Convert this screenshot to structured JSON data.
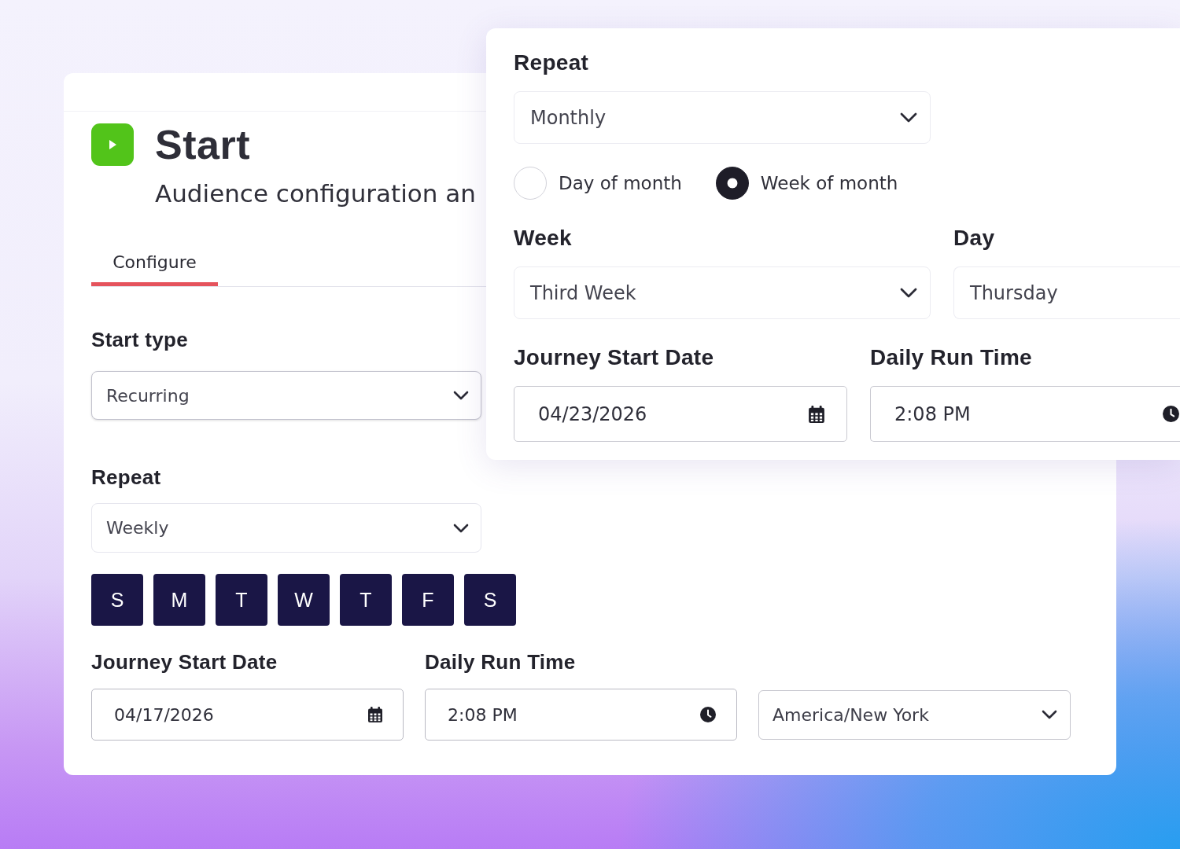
{
  "card": {
    "title": "Start",
    "subtitle": "Audience configuration an",
    "tabs": [
      {
        "label": "Configure",
        "selected": true
      }
    ],
    "start_type": {
      "label": "Start type",
      "value": "Recurring",
      "focused": true
    },
    "repeat": {
      "label": "Repeat",
      "value": "Weekly",
      "focused": false
    },
    "weekdays": [
      {
        "label": "S",
        "selected": true
      },
      {
        "label": "M",
        "selected": true
      },
      {
        "label": "T",
        "selected": true
      },
      {
        "label": "W",
        "selected": true
      },
      {
        "label": "T",
        "selected": true
      },
      {
        "label": "F",
        "selected": true
      },
      {
        "label": "S",
        "selected": true
      }
    ],
    "schedule": [
      {
        "kind": "date",
        "label": "Journey Start Date",
        "value": "04/17/2026"
      },
      {
        "kind": "time",
        "label": "Daily Run Time",
        "value": "2:08 PM"
      },
      {
        "kind": "select",
        "value": "America/New York"
      }
    ]
  },
  "monthly_panel": {
    "repeat": {
      "label": "Repeat",
      "value": "Monthly"
    },
    "options": [
      {
        "label": "Day of month",
        "selected": false
      },
      {
        "label": "Week of month",
        "selected": true
      }
    ],
    "week_day": [
      {
        "kind": "select",
        "label": "Week",
        "value": "Third Week"
      },
      {
        "kind": "text",
        "label": "Day",
        "value": "Thursday"
      }
    ],
    "schedule": [
      {
        "kind": "date",
        "label": "Journey Start Date",
        "value": "04/23/2026"
      },
      {
        "kind": "time",
        "label": "Daily Run Time",
        "value": "2:08 PM"
      }
    ]
  }
}
